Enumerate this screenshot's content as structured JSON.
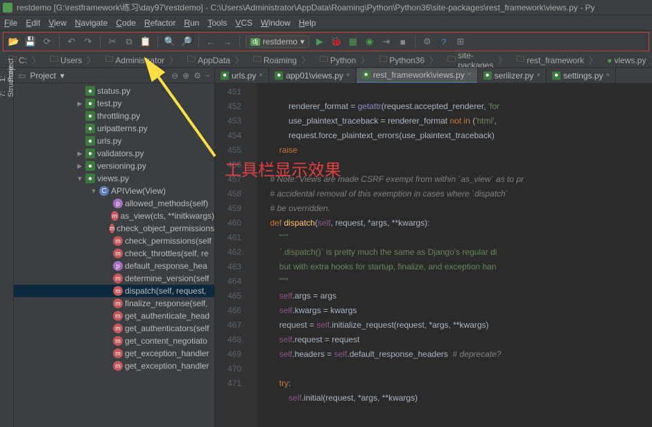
{
  "title": "restdemo [G:\\restframework\\练习\\day97\\restdemo] - C:\\Users\\Administrator\\AppData\\Roaming\\Python\\Python36\\site-packages\\rest_framework\\views.py - Py",
  "menu": [
    "File",
    "Edit",
    "View",
    "Navigate",
    "Code",
    "Refactor",
    "Run",
    "Tools",
    "VCS",
    "Window",
    "Help"
  ],
  "runconfig": "restdemo",
  "breadcrumbs": [
    "C:",
    "Users",
    "Administrator",
    "AppData",
    "Roaming",
    "Python",
    "Python36",
    "site-packages",
    "rest_framework",
    "views.py"
  ],
  "project_label": "Project",
  "tree": [
    {
      "indent": 90,
      "arrow": "",
      "icon": "py",
      "label": "status.py"
    },
    {
      "indent": 90,
      "arrow": "right",
      "icon": "py",
      "label": "test.py"
    },
    {
      "indent": 90,
      "arrow": "",
      "icon": "py",
      "label": "throttling.py"
    },
    {
      "indent": 90,
      "arrow": "",
      "icon": "py",
      "label": "urlpatterns.py"
    },
    {
      "indent": 90,
      "arrow": "",
      "icon": "py",
      "label": "urls.py"
    },
    {
      "indent": 90,
      "arrow": "right",
      "icon": "py",
      "label": "validators.py"
    },
    {
      "indent": 90,
      "arrow": "right",
      "icon": "py",
      "label": "versioning.py"
    },
    {
      "indent": 90,
      "arrow": "down",
      "icon": "py",
      "label": "views.py"
    },
    {
      "indent": 110,
      "arrow": "down",
      "icon": "cls",
      "label": "APIView(View)"
    },
    {
      "indent": 130,
      "arrow": "",
      "icon": "p",
      "label": "allowed_methods(self)"
    },
    {
      "indent": 130,
      "arrow": "",
      "icon": "m",
      "label": "as_view(cls, **initkwargs)"
    },
    {
      "indent": 130,
      "arrow": "",
      "icon": "m",
      "label": "check_object_permissions"
    },
    {
      "indent": 130,
      "arrow": "",
      "icon": "m",
      "label": "check_permissions(self"
    },
    {
      "indent": 130,
      "arrow": "",
      "icon": "m",
      "label": "check_throttles(self, re"
    },
    {
      "indent": 130,
      "arrow": "",
      "icon": "p",
      "label": "default_response_hea"
    },
    {
      "indent": 130,
      "arrow": "",
      "icon": "m",
      "label": "determine_version(self"
    },
    {
      "indent": 130,
      "arrow": "",
      "icon": "m",
      "label": "dispatch(self, request,",
      "sel": true
    },
    {
      "indent": 130,
      "arrow": "",
      "icon": "m",
      "label": "finalize_response(self,"
    },
    {
      "indent": 130,
      "arrow": "",
      "icon": "m",
      "label": "get_authenticate_head"
    },
    {
      "indent": 130,
      "arrow": "",
      "icon": "m",
      "label": "get_authenticators(self"
    },
    {
      "indent": 130,
      "arrow": "",
      "icon": "m",
      "label": "get_content_negotiato"
    },
    {
      "indent": 130,
      "arrow": "",
      "icon": "m",
      "label": "get_exception_handler"
    },
    {
      "indent": 130,
      "arrow": "",
      "icon": "m",
      "label": "get_exception_handler"
    }
  ],
  "tabs": [
    {
      "label": "urls.py",
      "active": false
    },
    {
      "label": "app01\\views.py",
      "active": false
    },
    {
      "label": "rest_framework\\views.py",
      "active": true
    },
    {
      "label": "serilizer.py",
      "active": false
    },
    {
      "label": "settings.py",
      "active": false
    }
  ],
  "gutter": [
    "451",
    "452",
    "453",
    "454",
    "455",
    "456",
    "457",
    "458",
    "459",
    "460",
    "461",
    "462",
    "463",
    "464",
    "465",
    "466",
    "467",
    "468",
    "469",
    "470",
    "471"
  ],
  "tokens": {
    "getattr": "getattr",
    "not": "not",
    "in": "in",
    "html": "'html'",
    "for": "'for",
    "raise": "raise",
    "def": "def",
    "dispatch": "dispatch",
    "self": "self",
    "try": "try",
    "initialize_request": "initialize_request",
    "doc1": "\"\"\"",
    "doc2": "`.dispatch()` is pretty much the same as Django's regular di",
    "doc3": "but with extra hooks for startup, finalize, and exception han",
    "doc4": "\"\"\"",
    "cmta": "# Note: Views are made CSRF exempt from within `as_view` as to pr",
    "cmtb": "# accidental removal of this exemption in cases where `dispatch`",
    "cmtc": "# be overridden.",
    "cmtd": "# deprecate?",
    "l451": "            renderer_format = ",
    "l451b": "(request.accepted_renderer, ",
    "l452": "            use_plaintext_traceback = renderer_format ",
    "l452b": " (",
    "l452c": ",",
    "l453": "            request.force_plaintext_errors(use_plaintext_traceback)",
    "l459": "    ",
    "l459b": "(",
    "l459c": ", request, *args, **kwargs):",
    "l464": "        ",
    "l464b": ".args = args",
    "l465": "        ",
    "l465b": ".kwargs = kwargs",
    "l466": "        request = ",
    "l466b": ".",
    "l466c": "(request, *args, **kwargs)",
    "l467": "        ",
    "l467b": ".request = request",
    "l468": "        ",
    "l468b": ".headers = ",
    "l468c": ".default_response_headers  ",
    "l470": "        ",
    "l470b": ":",
    "l471": "            ",
    "l471b": ".initial(request, *args, **kwargs)"
  },
  "overlay_text": "工具栏显示效果"
}
